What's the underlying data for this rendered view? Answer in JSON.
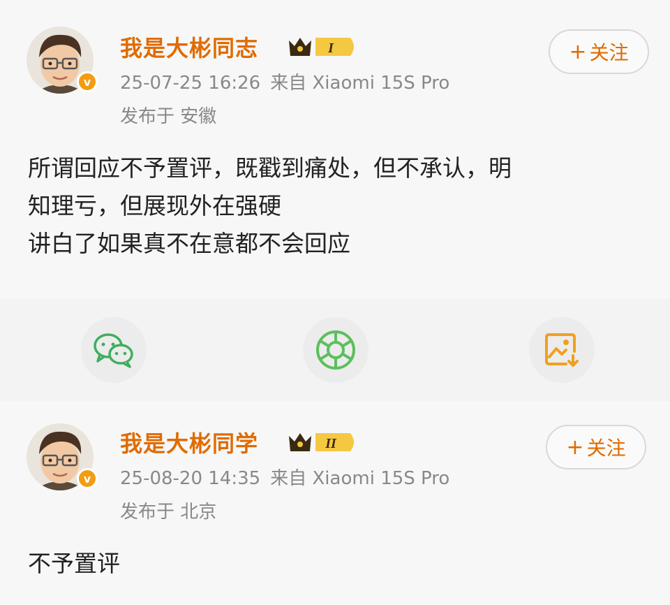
{
  "posts": [
    {
      "username": "我是大彬同志",
      "badge_level": "I",
      "date": "25-07-25 16:26",
      "source_prefix": "来自",
      "source_device": "Xiaomi 15S Pro",
      "location": "发布于 安徽",
      "follow_label": "关注",
      "follow_plus": "+",
      "verified_mark": "v",
      "text": "所谓回应不予置评，既戳到痛处，但不承认，明\n知理亏，但展现外在强硬\n讲白了如果真不在意都不会回应"
    },
    {
      "username": "我是大彬同学",
      "badge_level": "II",
      "date": "25-08-20 14:35",
      "source_prefix": "来自",
      "source_device": "Xiaomi 15S Pro",
      "location": "发布于 北京",
      "follow_label": "关注",
      "follow_plus": "+",
      "verified_mark": "v",
      "text": "不予置评"
    }
  ],
  "share_bar": {
    "icons": [
      "wechat-icon",
      "moments-icon",
      "save-image-icon"
    ]
  },
  "colors": {
    "accent": "#e06b00",
    "verified": "#f39c12",
    "wechat": "#3fae5f",
    "moments": "#5cbf5c",
    "save": "#f0a020"
  }
}
